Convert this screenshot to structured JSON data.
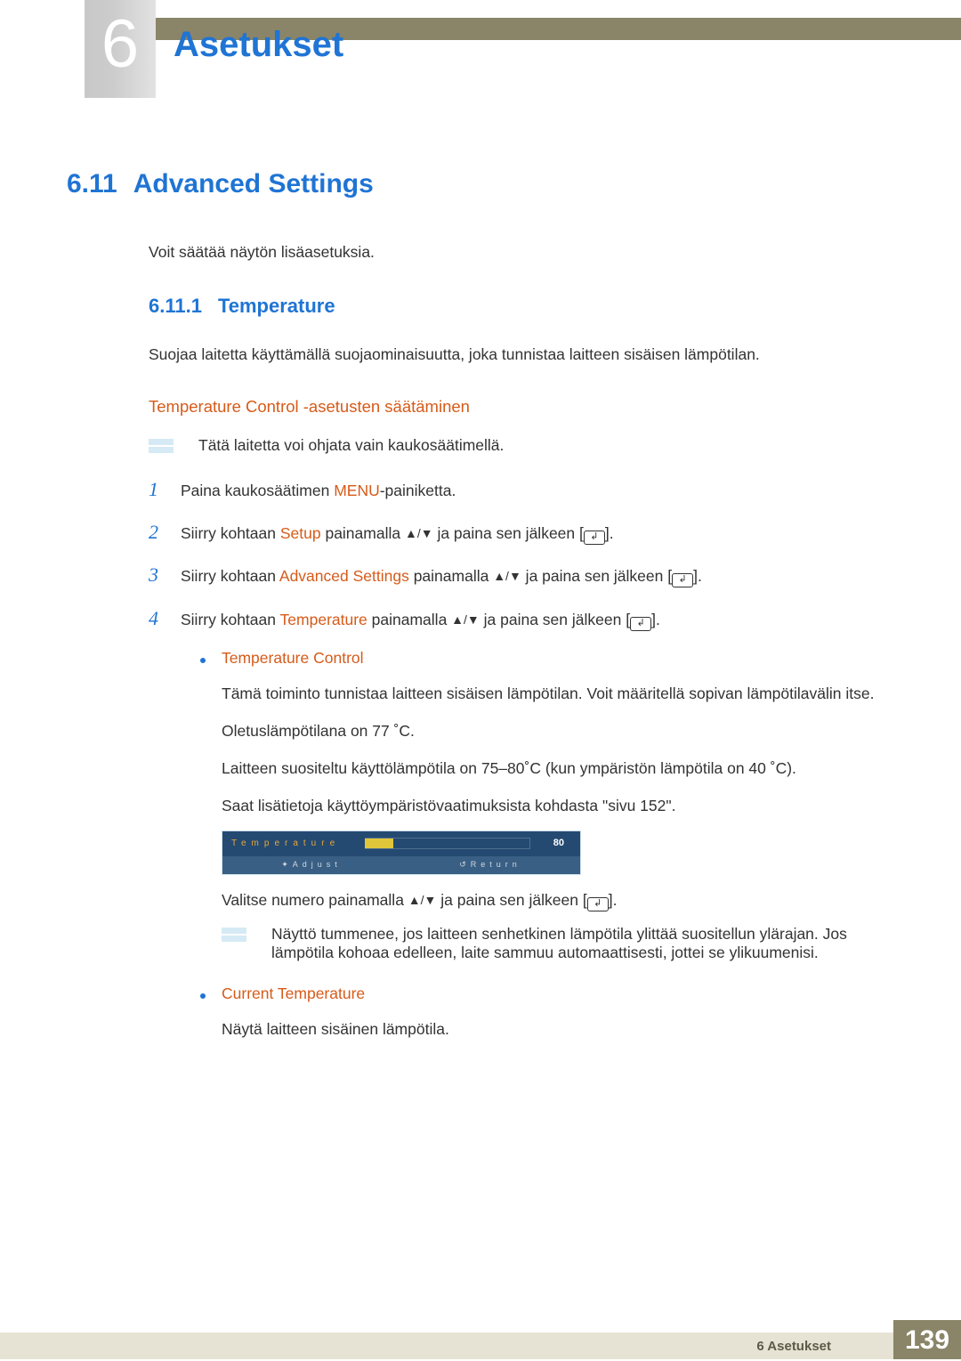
{
  "chapter": {
    "number": "6",
    "title": "Asetukset"
  },
  "section": {
    "number": "6.11",
    "title": "Advanced Settings"
  },
  "intro": "Voit säätää näytön lisäasetuksia.",
  "subsection": {
    "number": "6.11.1",
    "title": "Temperature"
  },
  "subsection_text": "Suojaa laitetta käyttämällä suojaominaisuutta, joka tunnistaa laitteen sisäisen lämpötilan.",
  "config_heading": "Temperature Control -asetusten säätäminen",
  "note1": "Tätä laitetta voi ohjata vain kaukosäätimellä.",
  "steps": {
    "s1": {
      "pre": "Paina kaukosäätimen ",
      "hl": "MENU",
      "post": "-painiketta."
    },
    "s2": {
      "pre": "Siirry kohtaan ",
      "hl": "Setup",
      "mid": " painamalla ",
      "post": " ja paina sen jälkeen [",
      "tail": "]."
    },
    "s3": {
      "pre": "Siirry kohtaan ",
      "hl": "Advanced Settings",
      "mid": " painamalla ",
      "post": " ja paina sen jälkeen [",
      "tail": "]."
    },
    "s4": {
      "pre": "Siirry kohtaan ",
      "hl": "Temperature",
      "mid": " painamalla ",
      "post": " ja paina sen jälkeen [",
      "tail": "]."
    }
  },
  "arrows": "▲/▼",
  "enter_glyph": "↲",
  "bullets": {
    "b1": {
      "title": "Temperature Control",
      "p1": "Tämä toiminto tunnistaa laitteen sisäisen lämpötilan. Voit määritellä sopivan lämpötilavälin itse.",
      "p2": "Oletuslämpötilana on 77 ˚C.",
      "p3": "Laitteen suositeltu käyttölämpötila on 75–80˚C (kun ympäristön lämpötila on 40 ˚C).",
      "p4": "Saat lisätietoja käyttöympäristövaatimuksista kohdasta \"sivu 152\".",
      "after_pre": "Valitse numero painamalla ",
      "after_post": " ja paina sen jälkeen [",
      "after_tail": "].",
      "note": "Näyttö tummenee, jos laitteen senhetkinen lämpötila ylittää suositellun ylärajan. Jos lämpötila kohoaa edelleen, laite sammuu automaattisesti, jottei se ylikuumenisi."
    },
    "b2": {
      "title": "Current Temperature",
      "p1": "Näytä laitteen sisäinen lämpötila."
    }
  },
  "osd": {
    "label": "Temperature",
    "value": "80",
    "adjust": "Adjust",
    "return": "Return"
  },
  "footer": {
    "text": "6 Asetukset",
    "page": "139"
  }
}
